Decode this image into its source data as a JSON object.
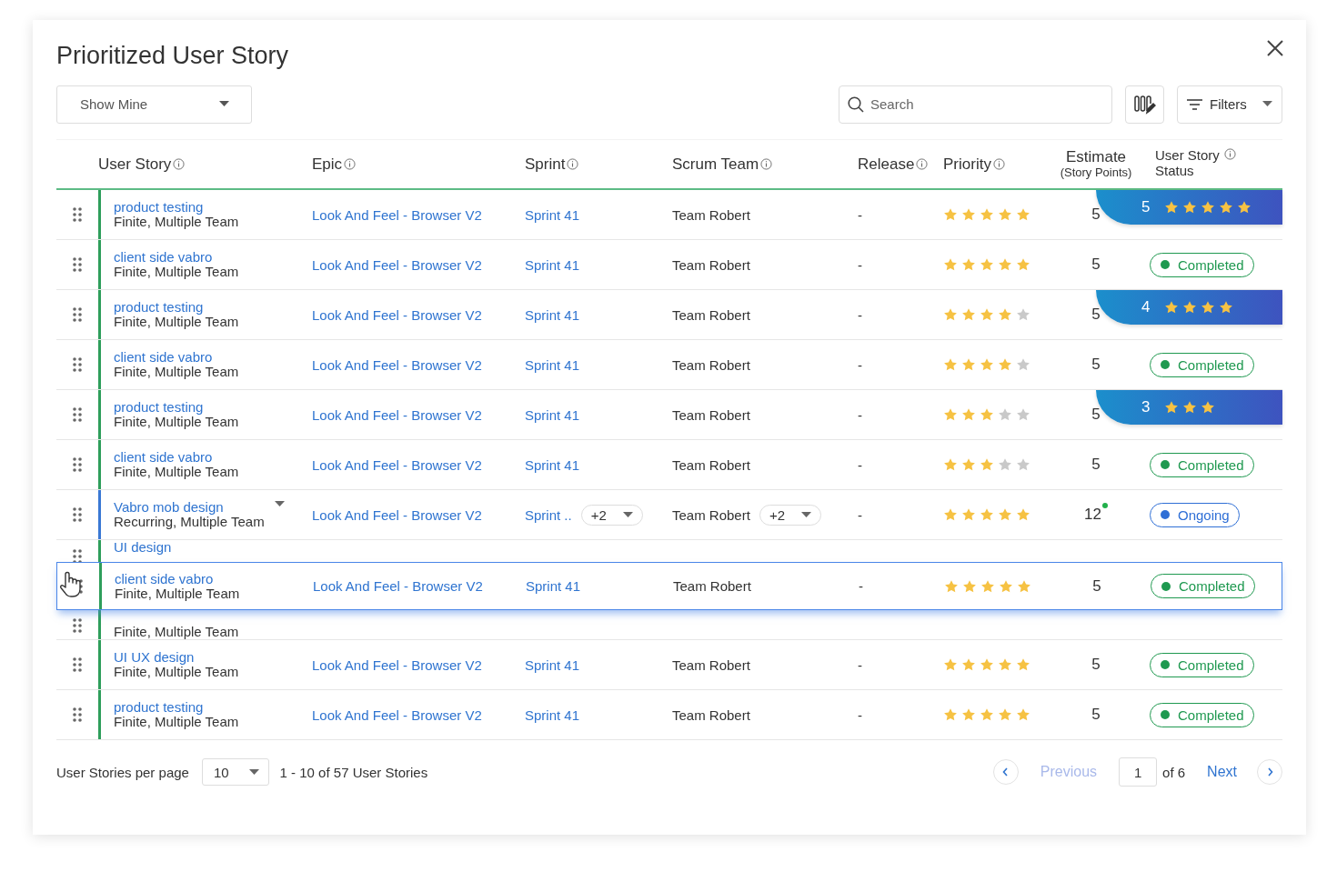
{
  "dialog": {
    "title": "Prioritized User Story"
  },
  "toolbar": {
    "view": "Show Mine",
    "search": {
      "placeholder": "Search"
    },
    "filters": "Filters"
  },
  "columns": [
    {
      "label": "User Story",
      "info": true
    },
    {
      "label": "Epic",
      "info": true
    },
    {
      "label": "Sprint",
      "info": true
    },
    {
      "label": "Scrum Team",
      "info": true
    },
    {
      "label": "Release",
      "info": true
    },
    {
      "label": "Priority",
      "info": true
    },
    {
      "label": "Estimate",
      "sub": "(Story Points)"
    },
    {
      "label": "User Story Status",
      "info": true
    }
  ],
  "rows": [
    {
      "kind": "full",
      "color": "#2e9e5b",
      "title": "product testing",
      "subtitle": "Finite, Multiple Team",
      "epic": "Look And Feel - Browser V2",
      "sprint": "Sprint 41",
      "team": "Team Robert",
      "release": "-",
      "stars": 5,
      "estimate": "5",
      "ribbon": {
        "value": "5",
        "stars": 5
      }
    },
    {
      "kind": "full",
      "color": "#2e9e5b",
      "title": "client side vabro",
      "subtitle": "Finite, Multiple Team",
      "epic": "Look And Feel - Browser V2",
      "sprint": "Sprint 41",
      "team": "Team Robert",
      "release": "-",
      "stars": 5,
      "estimate": "5",
      "status": {
        "label": "Completed",
        "color": "#1f9950"
      }
    },
    {
      "kind": "full",
      "color": "#2e9e5b",
      "title": "product testing",
      "subtitle": "Finite, Multiple Team",
      "epic": "Look And Feel - Browser V2",
      "sprint": "Sprint 41",
      "team": "Team Robert",
      "release": "-",
      "stars": 4,
      "estimate": "5",
      "ribbon": {
        "value": "4",
        "stars": 4
      }
    },
    {
      "kind": "full",
      "color": "#2e9e5b",
      "title": "client side vabro",
      "subtitle": "Finite, Multiple Team",
      "epic": "Look And Feel - Browser V2",
      "sprint": "Sprint 41",
      "team": "Team Robert",
      "release": "-",
      "stars": 4,
      "estimate": "5",
      "status": {
        "label": "Completed",
        "color": "#1f9950"
      }
    },
    {
      "kind": "full",
      "color": "#2e9e5b",
      "title": "product testing",
      "subtitle": "Finite, Multiple Team",
      "epic": "Look And Feel - Browser V2",
      "sprint": "Sprint 41",
      "team": "Team Robert",
      "release": "-",
      "stars": 3,
      "estimate": "5",
      "ribbon": {
        "value": "3",
        "stars": 3
      }
    },
    {
      "kind": "full",
      "color": "#2e9e5b",
      "title": "client side vabro",
      "subtitle": "Finite, Multiple Team",
      "epic": "Look And Feel - Browser V2",
      "sprint": "Sprint 41",
      "team": "Team Robert",
      "release": "-",
      "stars": 3,
      "estimate": "5",
      "status": {
        "label": "Completed",
        "color": "#1f9950"
      }
    },
    {
      "kind": "full",
      "color": "#3a78d4",
      "title": "Vabro mob design",
      "subtitle": "Recurring, Multiple Team",
      "menu": true,
      "epic": "Look And Feel - Browser V2",
      "sprint": "Sprint ..",
      "sprint_more": "+2",
      "team": "Team Robert",
      "team_more": "+2",
      "release": "-",
      "stars": 5,
      "estimate": "12",
      "flagged": true,
      "status": {
        "label": "Ongoing",
        "color": "#2f6fd6"
      }
    },
    {
      "kind": "top-part",
      "color": "#2e9e5b",
      "title": "UI design"
    },
    {
      "kind": "bottom-part",
      "color": "#2e9e5b",
      "subtitle": "Finite, Multiple Team"
    },
    {
      "kind": "full",
      "color": "#2e9e5b",
      "title": "UI UX design",
      "subtitle": "Finite, Multiple Team",
      "epic": "Look And Feel - Browser V2",
      "sprint": "Sprint 41",
      "team": "Team Robert",
      "release": "-",
      "stars": 5,
      "estimate": "5",
      "status": {
        "label": "Completed",
        "color": "#1f9950"
      }
    },
    {
      "kind": "full",
      "color": "#2e9e5b",
      "title": "product testing",
      "subtitle": "Finite, Multiple Team",
      "epic": "Look And Feel - Browser V2",
      "sprint": "Sprint 41",
      "team": "Team Robert",
      "release": "-",
      "stars": 5,
      "estimate": "5",
      "status": {
        "label": "Completed",
        "color": "#1f9950"
      }
    }
  ],
  "dragging": {
    "kind": "full",
    "color": "#2e9e5b",
    "title": "client side vabro",
    "subtitle": "Finite, Multiple Team",
    "epic": "Look And Feel - Browser V2",
    "sprint": "Sprint 41",
    "team": "Team Robert",
    "release": "-",
    "stars": 5,
    "estimate": "5",
    "status": {
      "label": "Completed",
      "color": "#1f9950"
    }
  },
  "footer": {
    "per_page_label": "User Stories per page",
    "per_page": "10",
    "range": "1 - 10 of 57 User Stories",
    "previous": {
      "label": "Previous",
      "disabled": true
    },
    "page": "1",
    "of": "of 6",
    "next": {
      "label": "Next",
      "disabled": false
    }
  }
}
